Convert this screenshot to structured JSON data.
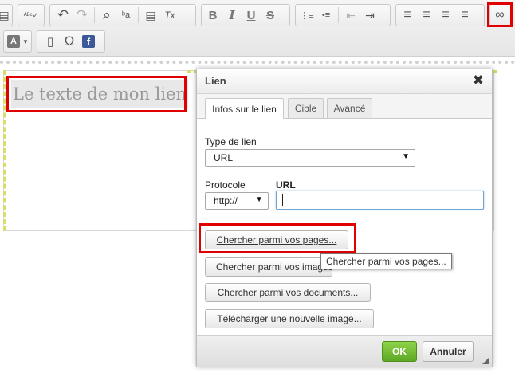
{
  "toolbar": {
    "row1": [
      {
        "name": "paste-icon",
        "glyph": "▤"
      },
      {
        "name": "spellcheck-icon",
        "glyph": "ᴬᴮᶜ✓"
      },
      {
        "name": "undo-icon",
        "glyph": "↶"
      },
      {
        "name": "redo-icon",
        "glyph": "↷"
      },
      {
        "name": "find-icon",
        "glyph": "⌕"
      },
      {
        "name": "replace-icon",
        "glyph": "ᵇa"
      },
      {
        "name": "select-all-icon",
        "glyph": "▤"
      },
      {
        "name": "remove-format-icon",
        "glyph": "Tx"
      },
      {
        "name": "bold-icon",
        "glyph": "B"
      },
      {
        "name": "italic-icon",
        "glyph": "I"
      },
      {
        "name": "underline-icon",
        "glyph": "U"
      },
      {
        "name": "strike-icon",
        "glyph": "S"
      },
      {
        "name": "numbered-list-icon",
        "glyph": "⋮≡"
      },
      {
        "name": "bulleted-list-icon",
        "glyph": "•≡"
      },
      {
        "name": "outdent-icon",
        "glyph": "⇤"
      },
      {
        "name": "indent-icon",
        "glyph": "⇥"
      },
      {
        "name": "align-left-icon",
        "glyph": "≡"
      },
      {
        "name": "align-center-icon",
        "glyph": "≡"
      },
      {
        "name": "align-right-icon",
        "glyph": "≡"
      },
      {
        "name": "justify-icon",
        "glyph": "≡"
      },
      {
        "name": "link-icon",
        "glyph": "∞"
      }
    ],
    "row2": [
      {
        "name": "text-color-icon",
        "glyph": "A"
      },
      {
        "name": "page-break-icon",
        "glyph": "▯"
      },
      {
        "name": "special-char-icon",
        "glyph": "Ω"
      },
      {
        "name": "facebook-icon",
        "glyph": "f"
      }
    ],
    "accent_highlight": "#e10000"
  },
  "editor": {
    "link_text": "Le texte de mon lien"
  },
  "dialog": {
    "title": "Lien",
    "close_glyph": "✖",
    "tabs": [
      {
        "label": "Infos sur le lien",
        "active": true
      },
      {
        "label": "Cible",
        "active": false
      },
      {
        "label": "Avancé",
        "active": false
      }
    ],
    "link_type_label": "Type de lien",
    "link_type_value": "URL",
    "protocol_label": "Protocole",
    "protocol_value": "http://",
    "url_label": "URL",
    "url_value": "",
    "buttons": {
      "browse_pages": "Chercher parmi vos pages...",
      "browse_images": "Chercher parmi vos images...",
      "browse_documents": "Chercher parmi vos documents...",
      "upload_image": "Télécharger une nouvelle image..."
    },
    "tooltip": "Chercher parmi vos pages...",
    "ok_label": "OK",
    "cancel_label": "Annuler",
    "ok_color": "#6cb52f"
  }
}
